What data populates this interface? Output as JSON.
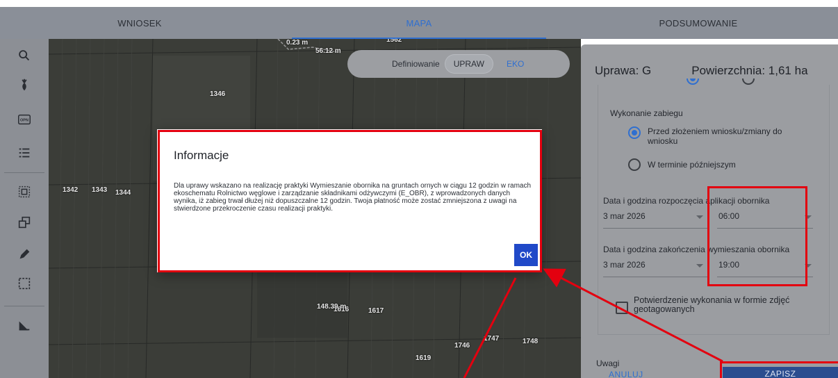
{
  "tabs": [
    {
      "label": "WNIOSEK",
      "active": false
    },
    {
      "label": "MAPA",
      "active": true
    },
    {
      "label": "PODSUMOWANIE",
      "active": false
    }
  ],
  "toolbar": {
    "icons": [
      "search-icon",
      "plant-icon",
      "opn-icon",
      "list-icon",
      "select-area-icon",
      "copy-shapes-icon",
      "pencil-icon",
      "dashed-rectangle-icon",
      "measure-icon"
    ],
    "opn_text": "OPN"
  },
  "map": {
    "scale_labels": [
      "0.23 m",
      "56.12 m",
      "1562"
    ],
    "parcel_labels": [
      "1346",
      "1342",
      "1343",
      "1344",
      "1616",
      "1617",
      "1746",
      "1747",
      "1748",
      "1619",
      "148.39 m"
    ],
    "definiowanie": {
      "label": "Definiowanie",
      "options": [
        "UPRAW",
        "EKO"
      ],
      "active": "UPRAW"
    }
  },
  "panel": {
    "uprawa_label": "Uprawa: G",
    "powierzchnia_label": "Powierzchnia: 1,61 ha",
    "wykonanie_label": "Wykonanie zabiegu",
    "radio_before": "Przed złożeniem wniosku/zmiany do wniosku",
    "radio_later": "W terminie późniejszym",
    "start_label": "Data i godzina rozpoczęcia aplikacji obornika",
    "start_date": "3 mar 2026",
    "start_time": "06:00",
    "end_label": "Data i godzina zakończenia wymieszania obornika",
    "end_date": "3 mar 2026",
    "end_time": "19:00",
    "photo_confirm": "Potwierdzenie wykonania w formie zdjęć geotagowanych",
    "uwagi_label": "Uwagi",
    "cancel_label": "ANULUJ",
    "save_label": "ZAPISZ"
  },
  "dialog": {
    "title": "Informacje",
    "message": "Dla uprawy wskazano na realizację praktyki Wymieszanie obornika na gruntach ornych w ciągu 12 godzin w ramach ekoschematu Rolnictwo węglowe i zarządzanie składnikami odżywczymi (E_OBR), z wprowadzonych danych wynika, iż zabieg trwał dłużej niż dopuszczalne 12 godzin. Twoja płatność może zostać zmniejszona z uwagi na stwierdzone przekroczenie czasu realizacji praktyki.",
    "ok_label": "OK"
  },
  "colors": {
    "accent": "#2f6fd0",
    "annotation_red": "#e3000f",
    "ok_button": "#2049c8"
  }
}
